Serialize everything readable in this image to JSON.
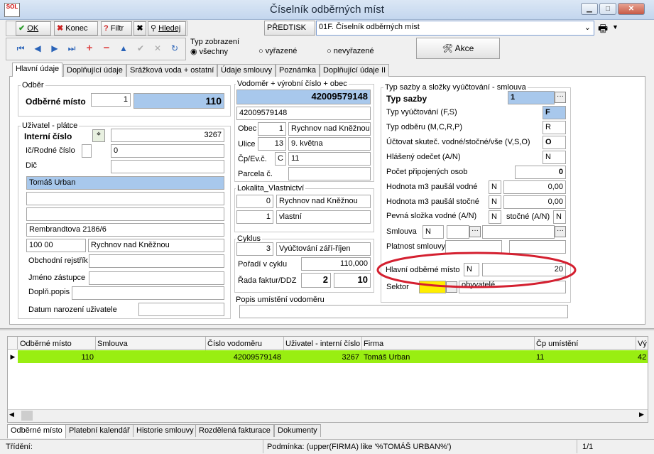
{
  "title": "Číselník odběrných míst",
  "logo_text": "SOL",
  "window": {
    "minimize": "▁",
    "maximize": "□",
    "close": "✕"
  },
  "toolbar": {
    "ok": "OK",
    "konec": "Konec",
    "filtr": "Filtr",
    "hledej": "Hledej",
    "predtisk": "PŘEDTISK",
    "print_select": "01F. Číselník odběrných míst",
    "akce": "Akce"
  },
  "view": {
    "label": "Typ zobrazení",
    "all": "všechny",
    "selected": "vyřazené",
    "unselected": "nevyřazené"
  },
  "tabs": [
    "Hlavní údaje",
    "Doplňující údaje",
    "Srážková voda + ostatní",
    "Údaje smlouvy",
    "Poznámka",
    "Doplňující údaje II"
  ],
  "odber": {
    "group": "Odběr",
    "label": "Odběrné místo",
    "num": "1",
    "value": "110"
  },
  "uzivatel": {
    "group": "Uživatel - plátce",
    "interni_label": "Interní číslo",
    "interni": "3267",
    "ic_label": "Ič/Rodné číslo",
    "ic": "0",
    "dic_label": "Dič",
    "name": "Tomáš Urban",
    "address": "Rembrandtova 2186/6",
    "psc": "100 00",
    "city": "Rychnov nad Kněžnou",
    "obchodni_label": "Obchodní rejstřík",
    "zastupce_label": "Jméno zástupce",
    "doplnpopis_label": "Doplň.popis",
    "datum_label": "Datum narození uživatele"
  },
  "vodomer": {
    "group": "Vodoměr + výrobní číslo + obec",
    "number": "42009579148",
    "number2": "42009579148",
    "obec_label": "Obec",
    "obec_num": "1",
    "obec": "Rychnov nad Kněžnou",
    "ulice_label": "Ulice",
    "ulice_num": "13",
    "ulice": "9. května",
    "cp_label": "Čp/Ev.č.",
    "cp_type": "C",
    "cp": "11",
    "parcela_label": "Parcela č."
  },
  "lokalita": {
    "group": "Lokalita_Vlastnictví",
    "num1": "0",
    "val1": "Rychnov nad Kněžnou",
    "num2": "1",
    "val2": "vlastní"
  },
  "cyklus": {
    "group": "Cyklus",
    "num": "3",
    "value": "Vyúčtování září-říjen",
    "poradi_label": "Pořadí v cyklu",
    "poradi": "110,000",
    "rada_label": "Řada faktur/DDZ",
    "rada1": "2",
    "rada2": "10"
  },
  "popis": {
    "label": "Popis umístění vodoměru"
  },
  "sazby": {
    "group": "Typ sazby a složky vyúčtování - smlouva",
    "typ_label": "Typ sazby",
    "typ": "1",
    "vyuct_label": "Typ vyúčtování (F,S)",
    "vyuct": "F",
    "odber_label": "Typ odběru (M,C,R,P)",
    "odber": "R",
    "uctovat_label": "Účtovat skuteč. vodné/stočné/vše (V,S,O)",
    "uctovat": "O",
    "odecet_label": "Hlášený odečet (A/N)",
    "odecet": "N",
    "osob_label": "Počet připojených osob",
    "osob": "0",
    "vodne_label": "Hodnota m3 paušál vodné",
    "vodne_flag": "N",
    "vodne": "0,00",
    "stocne_label": "Hodnota m3 paušál stočné",
    "stocne_flag": "N",
    "stocne": "0,00",
    "pevna_label": "Pevná složka vodné (A/N)",
    "pevna": "N",
    "pevna_stocne_label": "stočné (A/N)",
    "pevna_stocne": "N",
    "smlouva_label": "Smlouva",
    "smlouva": "N",
    "platnost_label": "Platnost smlouvy",
    "hlavni_label": "Hlavní odběrné místo",
    "hlavni_flag": "N",
    "hlavni": "20",
    "sektor_label": "Sektor",
    "sektor": "obyvatelé"
  },
  "grid": {
    "headers": [
      "Odběrné místo",
      "Smlouva",
      "Číslo vodoměru",
      "Uživatel - interní číslo",
      "Firma",
      "Čp umístění",
      "Vý"
    ],
    "row": [
      "110",
      "",
      "42009579148",
      "3267",
      "Tomáš Urban",
      "11",
      "42"
    ]
  },
  "bottom_tabs": [
    "Odběrné místo",
    "Platební kalendář",
    "Historie smlouvy",
    "Rozdělená fakturace",
    "Dokumenty"
  ],
  "status": {
    "trideni": "Třídění:",
    "podminka": "Podmínka: (upper(FIRMA) like '%TOMÁŠ URBAN%')",
    "pages": "1/1"
  },
  "colors": {
    "highlight": "#99ee11",
    "blue": "#a8c8ec",
    "annotation": "#d42030"
  }
}
